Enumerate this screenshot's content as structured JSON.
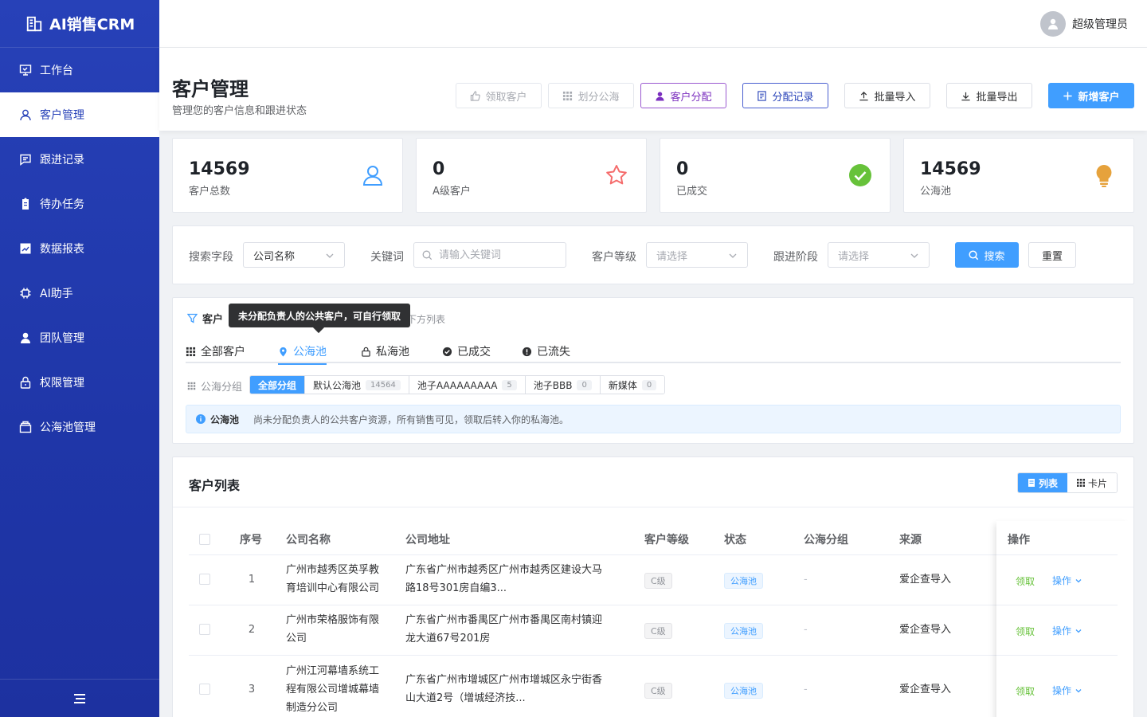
{
  "app": {
    "title": "AI销售CRM"
  },
  "sidebar": {
    "items": [
      {
        "label": "工作台",
        "icon": "presentation-board-icon"
      },
      {
        "label": "客户管理",
        "icon": "user-icon",
        "active": true
      },
      {
        "label": "跟进记录",
        "icon": "message-icon"
      },
      {
        "label": "待办任务",
        "icon": "clipboard-icon"
      },
      {
        "label": "数据报表",
        "icon": "chart-icon"
      },
      {
        "label": "AI助手",
        "icon": "chip-icon"
      },
      {
        "label": "团队管理",
        "icon": "user-fill-icon"
      },
      {
        "label": "权限管理",
        "icon": "lock-icon"
      },
      {
        "label": "公海池管理",
        "icon": "box-icon"
      }
    ]
  },
  "user": {
    "name": "超级管理员"
  },
  "page": {
    "title": "客户管理",
    "subtitle": "管理您的客户信息和跟进状态",
    "actions": {
      "claim": "领取客户",
      "assign_pool": "划分公海",
      "distribute": "客户分配",
      "records": "分配记录",
      "import": "批量导入",
      "export": "批量导出",
      "add": "新增客户"
    }
  },
  "stats": [
    {
      "value": "14569",
      "label": "客户总数"
    },
    {
      "value": "0",
      "label": "A级客户"
    },
    {
      "value": "0",
      "label": "已成交"
    },
    {
      "value": "14569",
      "label": "公海池"
    }
  ],
  "search": {
    "field_label": "搜索字段",
    "field_value": "公司名称",
    "keyword_label": "关键词",
    "keyword_placeholder": "请输入关键词",
    "level_label": "客户等级",
    "level_placeholder": "请选择",
    "stage_label": "跟进阶段",
    "stage_placeholder": "请选择",
    "search_btn": "搜索",
    "reset_btn": "重置"
  },
  "pool": {
    "title": "客户",
    "hint": "下方列表",
    "tooltip": "未分配负责人的公共客户，可自行领取",
    "tabs": [
      {
        "label": "全部客户"
      },
      {
        "label": "公海池",
        "active": true
      },
      {
        "label": "私海池"
      },
      {
        "label": "已成交"
      },
      {
        "label": "已流失"
      }
    ],
    "groups_label": "公海分组",
    "groups": [
      {
        "label": "全部分组",
        "active": true
      },
      {
        "label": "默认公海池",
        "count": "14564"
      },
      {
        "label": "池子AAAAAAAAA",
        "count": "5"
      },
      {
        "label": "池子BBB",
        "count": "0"
      },
      {
        "label": "新媒体",
        "count": "0"
      }
    ],
    "info_title": "公海池",
    "info_text": "尚未分配负责人的公共客户资源，所有销售可见，领取后转入你的私海池。"
  },
  "list": {
    "title": "客户列表",
    "view_list": "列表",
    "view_card": "卡片",
    "columns": {
      "index": "序号",
      "company": "公司名称",
      "address": "公司地址",
      "level": "客户等级",
      "status": "状态",
      "group": "公海分组",
      "source": "来源",
      "actions": "操作"
    },
    "rows": [
      {
        "index": "1",
        "company_l1": "广州市越秀区英孚教",
        "company_l2": "育培训中心有限公司",
        "company_l3": "",
        "address_l1": "广东省广州市越秀区广州市越秀区建设大马",
        "address_l2": "路18号301房自编3...",
        "level": "C级",
        "status": "公海池",
        "group": "-",
        "source": "爱企查导入",
        "claim": "领取",
        "op": "操作"
      },
      {
        "index": "2",
        "company_l1": "广州市荣格服饰有限",
        "company_l2": "公司",
        "company_l3": "",
        "address_l1": "广东省广州市番禺区广州市番禺区南村镇迎",
        "address_l2": "龙大道67号201房",
        "level": "C级",
        "status": "公海池",
        "group": "-",
        "source": "爱企查导入",
        "claim": "领取",
        "op": "操作"
      },
      {
        "index": "3",
        "company_l1": "广州江河幕墙系统工",
        "company_l2": "程有限公司增城幕墙",
        "company_l3": "制造分公司",
        "address_l1": "广东省广州市增城区广州市增城区永宁街香",
        "address_l2": "山大道2号（增城经济技...",
        "level": "C级",
        "status": "公海池",
        "group": "-",
        "source": "爱企查导入",
        "claim": "领取",
        "op": "操作"
      }
    ]
  },
  "colors": {
    "sidebar": "#2741b8",
    "primary": "#409eff",
    "success": "#67c23a"
  }
}
